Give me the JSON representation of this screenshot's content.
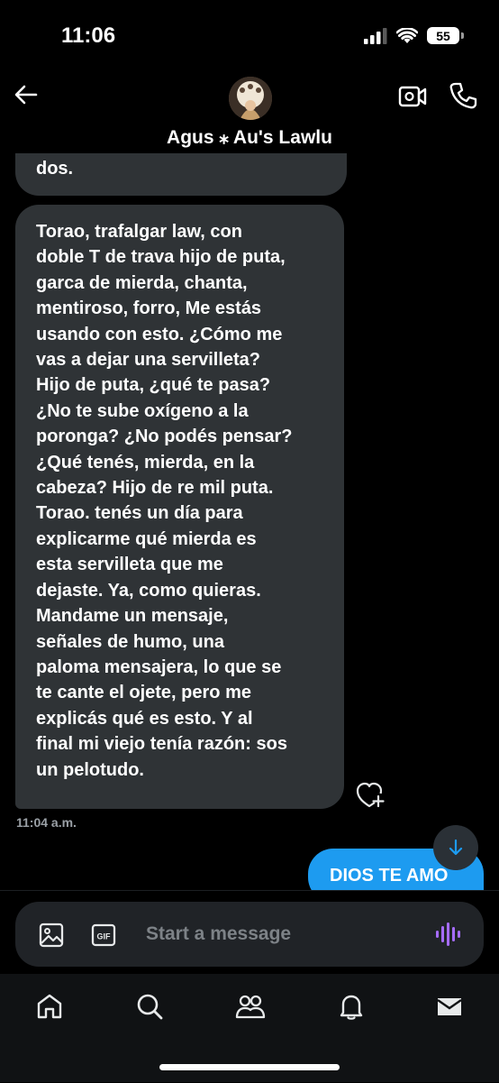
{
  "status_bar": {
    "time": "11:06",
    "battery": "55"
  },
  "header": {
    "contact_name": "Agus ⁎ Au's Lawlu",
    "icons": [
      "back-arrow-icon",
      "video-call-icon",
      "phone-call-icon"
    ]
  },
  "conversation": {
    "previous_bubble_tail": "dos.",
    "main_message_lines": [
      "Torao, trafalgar law, con",
      "doble T de trava hijo de puta,",
      "garca de mierda, chanta,",
      "mentiroso, forro, Me estás",
      "usando con esto. ¿Cómo me",
      "vas a dejar una servilleta?",
      "Hijo de puta, ¿qué te pasa?",
      "¿No te sube oxígeno a la",
      "poronga? ¿No podés pensar?",
      "¿Qué tenés, mierda, en la",
      "cabeza? Hijo de re mil puta.",
      "Torao. tenés un día para",
      "explicarme qué mierda es",
      "esta servilleta que me",
      "dejaste. Ya, como quieras.",
      "Mandame un mensaje,",
      "señales de humo, una",
      "paloma mensajera, lo que se",
      "te cante el ojete, pero me",
      "explicás qué es esto. Y al",
      "final mi viejo tenía razón: sos",
      "un pelotudo."
    ],
    "message_time": "11:04 a.m.",
    "sent_message": "DIOS TE AMO"
  },
  "composer": {
    "placeholder": "Start a message"
  },
  "tab_bar": {
    "items": [
      "home-icon",
      "search-icon",
      "communities-icon",
      "notifications-icon",
      "messages-icon"
    ]
  },
  "colors": {
    "background": "#000000",
    "received_bubble": "#2f3336",
    "sent_bubble": "#1d9bf0",
    "voice_icon": "#a66cff"
  }
}
